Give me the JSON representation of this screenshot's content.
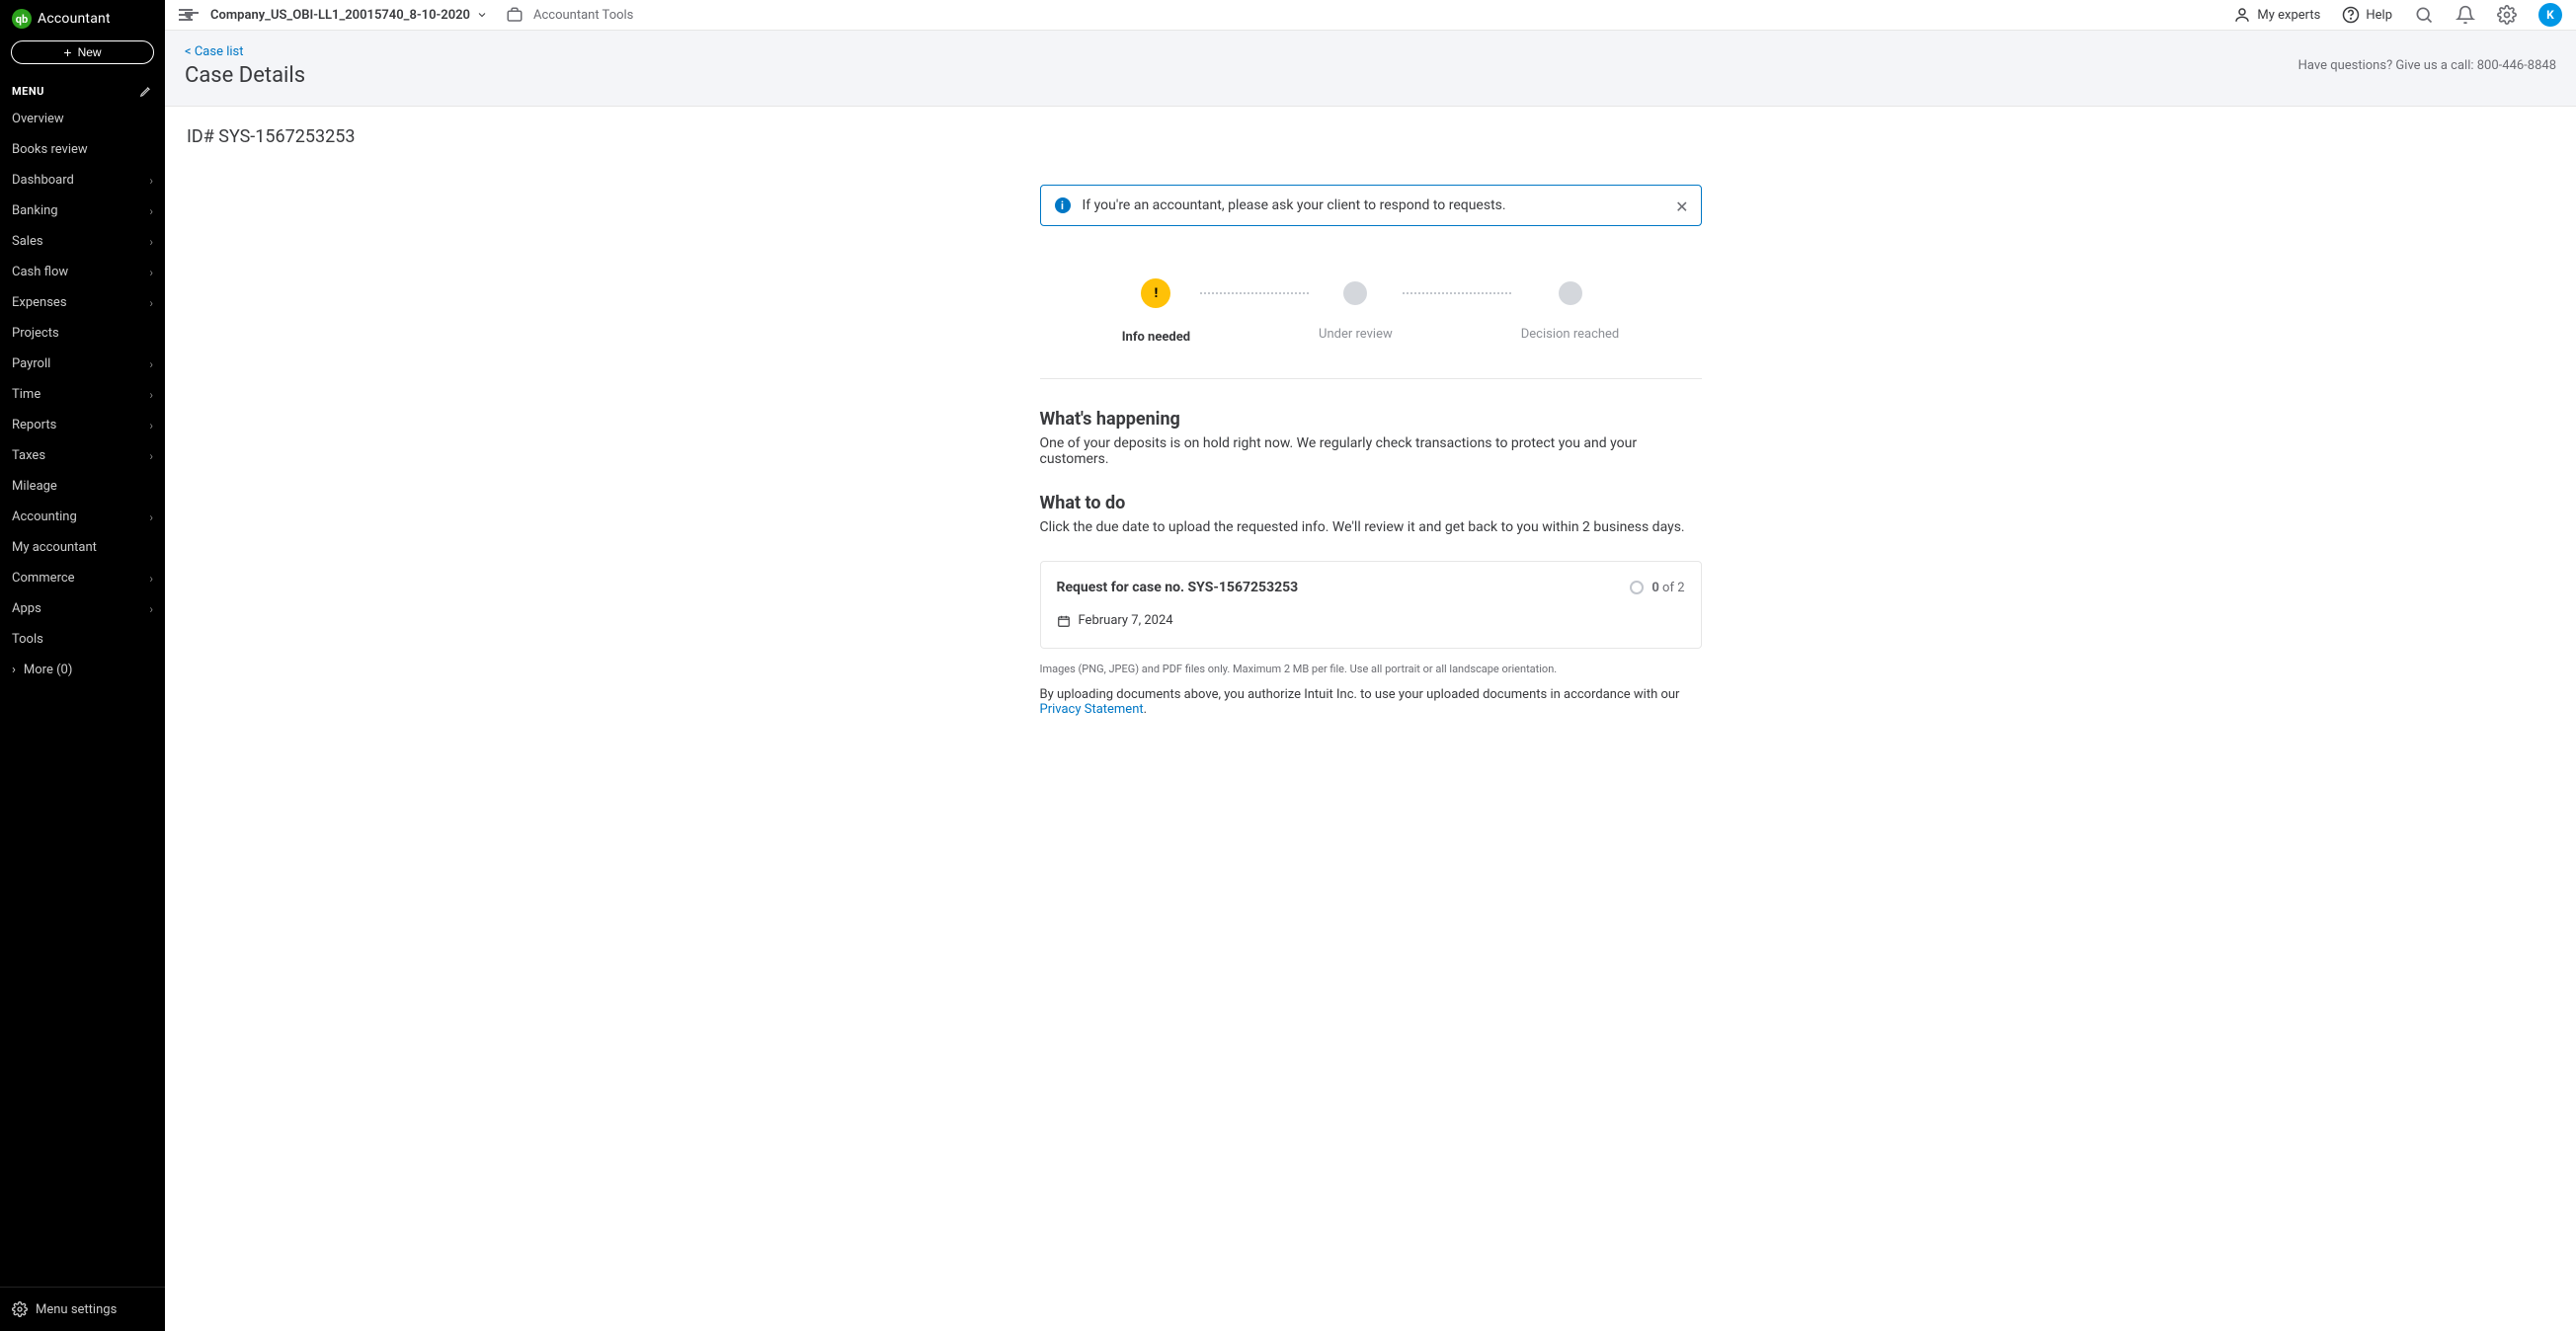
{
  "brand": {
    "logo_text": "qb",
    "product": "Accountant"
  },
  "new_button": {
    "label": "New"
  },
  "menu_header": "MENU",
  "sidebar": {
    "items": [
      {
        "label": "Overview",
        "has_children": false
      },
      {
        "label": "Books review",
        "has_children": false
      },
      {
        "label": "Dashboard",
        "has_children": true
      },
      {
        "label": "Banking",
        "has_children": true
      },
      {
        "label": "Sales",
        "has_children": true
      },
      {
        "label": "Cash flow",
        "has_children": true
      },
      {
        "label": "Expenses",
        "has_children": true
      },
      {
        "label": "Projects",
        "has_children": false
      },
      {
        "label": "Payroll",
        "has_children": true
      },
      {
        "label": "Time",
        "has_children": true
      },
      {
        "label": "Reports",
        "has_children": true
      },
      {
        "label": "Taxes",
        "has_children": true
      },
      {
        "label": "Mileage",
        "has_children": false
      },
      {
        "label": "Accounting",
        "has_children": true
      },
      {
        "label": "My accountant",
        "has_children": false
      },
      {
        "label": "Commerce",
        "has_children": true
      },
      {
        "label": "Apps",
        "has_children": true
      },
      {
        "label": "Tools",
        "has_children": false
      }
    ],
    "more_label": "More (0)",
    "settings_label": "Menu settings"
  },
  "topbar": {
    "company_name": "Company_US_OBI-LL1_20015740_8-10-2020",
    "accountant_tools": "Accountant Tools",
    "my_experts": "My experts",
    "help": "Help",
    "avatar_initial": "K"
  },
  "page": {
    "breadcrumb": "< Case list",
    "title": "Case Details",
    "questions": "Have questions? Give us a call: 800-446-8848",
    "case_id_label": "ID# SYS-1567253253"
  },
  "alert": {
    "text": "If you're an accountant, please ask your client to respond to requests."
  },
  "stepper": {
    "steps": [
      {
        "label": "Info needed",
        "active": true
      },
      {
        "label": "Under review",
        "active": false
      },
      {
        "label": "Decision reached",
        "active": false
      }
    ]
  },
  "happening": {
    "heading": "What's happening",
    "text": "One of your deposits is on hold right now. We regularly check transactions to protect you and your customers."
  },
  "todo": {
    "heading": "What to do",
    "text": "Click the due date to upload the requested info. We'll review it and get back to you within 2 business days."
  },
  "request": {
    "title": "Request for case no. SYS-1567253253",
    "count_done": "0",
    "count_total": "of 2",
    "due_date": "February 7, 2024"
  },
  "fine_print": "Images (PNG, JPEG) and PDF files only. Maximum 2 MB per file. Use all portrait or all landscape orientation.",
  "upload_note_prefix": "By uploading documents above, you authorize Intuit Inc. to use your uploaded documents in accordance with our ",
  "upload_note_link": "Privacy Statement",
  "upload_note_suffix": "."
}
